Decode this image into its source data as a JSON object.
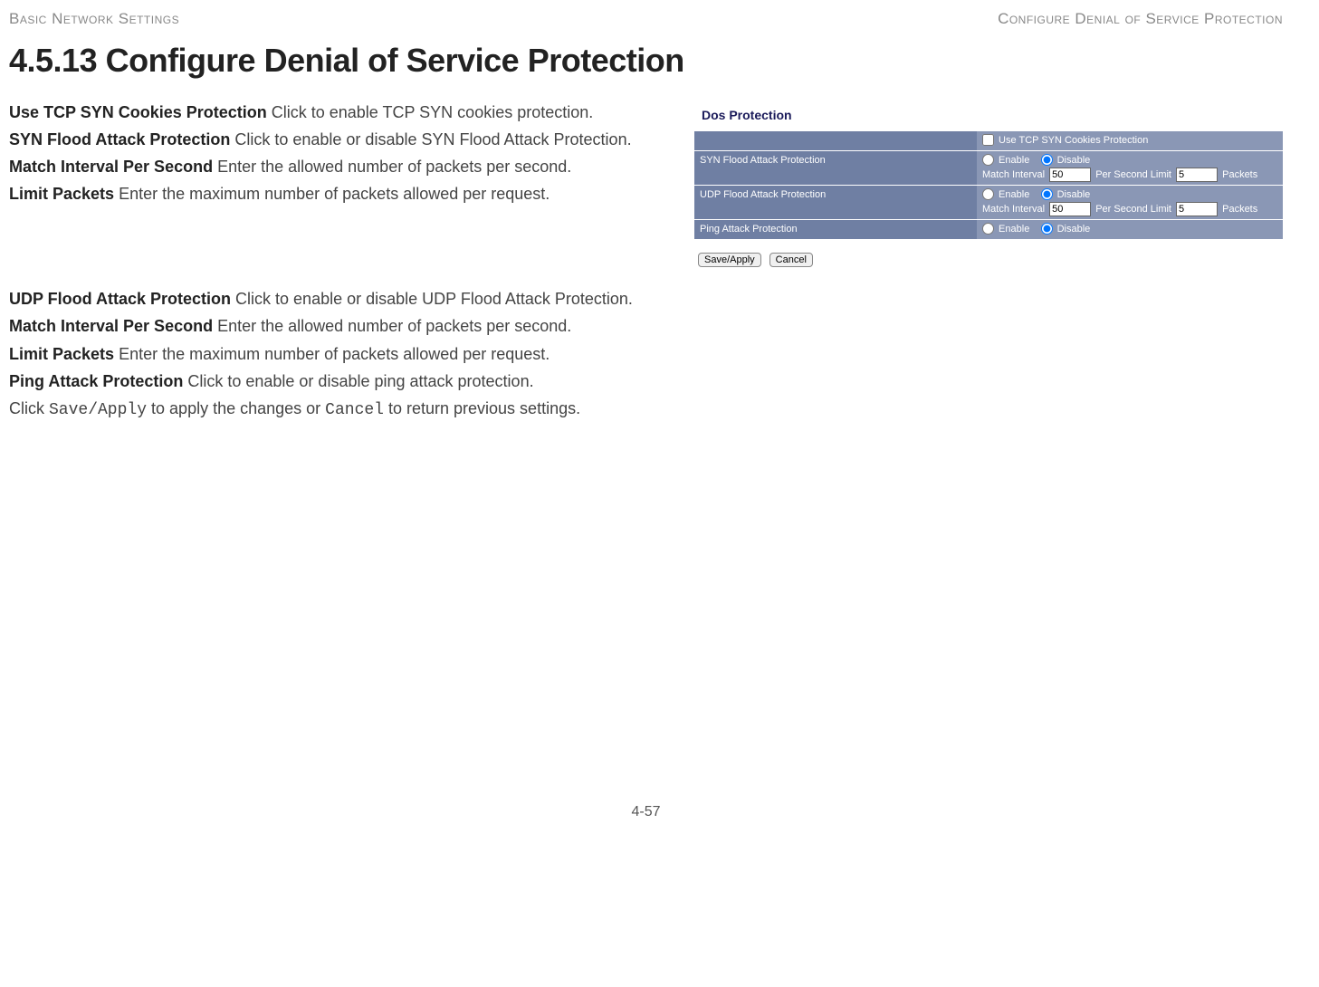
{
  "header": {
    "left": "Basic Network Settings",
    "right": "Configure Denial of Service Protection"
  },
  "title": "4.5.13 Configure Denial of Service Protection",
  "doc": {
    "p1_lead": "Use TCP SYN Cookies Protection",
    "p1_body": "  Click to enable TCP SYN cookies protection.",
    "p2_lead": "SYN Flood Attack Protection",
    "p2_body": "  Click to enable or disable SYN Flood Attack Protection.",
    "p3_lead": "Match Interval Per Second",
    "p3_body": "   Enter the allowed number of packets per second.",
    "p4_lead": "Limit Packets",
    "p4_body": "  Enter the maximum number of packets allowed per request.",
    "p5_lead": "UDP Flood Attack Protection",
    "p5_body": "  Click to enable or disable UDP Flood Attack Protection.",
    "p6_lead": "Match Interval Per Second",
    "p6_body": "   Enter the allowed number of packets per second.",
    "p7_lead": "Limit Packets",
    "p7_body": "  Enter the maximum number of packets allowed per request.",
    "p8_lead": "Ping Attack Protection",
    "p8_body": "  Click to enable or disable ping attack protection.",
    "final_a": "Click ",
    "final_code1": "Save/Apply",
    "final_b": " to apply the changes or ",
    "final_code2": "Cancel",
    "final_c": " to return previous settings."
  },
  "panel": {
    "title": "Dos Protection",
    "row0_check_label": " Use TCP SYN Cookies Protection",
    "row1_label": "SYN Flood Attack Protection",
    "row1_enable": " Enable",
    "row1_disable": " Disable",
    "row1_mi_label": "Match Interval",
    "row1_mi_value": "50",
    "row1_psl_label": "Per Second  Limit",
    "row1_psl_value": "5",
    "row1_pkts": "Packets",
    "row2_label": "UDP Flood Attack Protection",
    "row2_enable": " Enable",
    "row2_disable": " Disable",
    "row2_mi_label": "Match Interval",
    "row2_mi_value": "50",
    "row2_psl_label": "Per Second  Limit",
    "row2_psl_value": "5",
    "row2_pkts": "Packets",
    "row3_label": "Ping Attack Protection",
    "row3_enable": " Enable",
    "row3_disable": " Disable",
    "btn_save": "Save/Apply",
    "btn_cancel": "Cancel"
  },
  "footer": "4-57"
}
